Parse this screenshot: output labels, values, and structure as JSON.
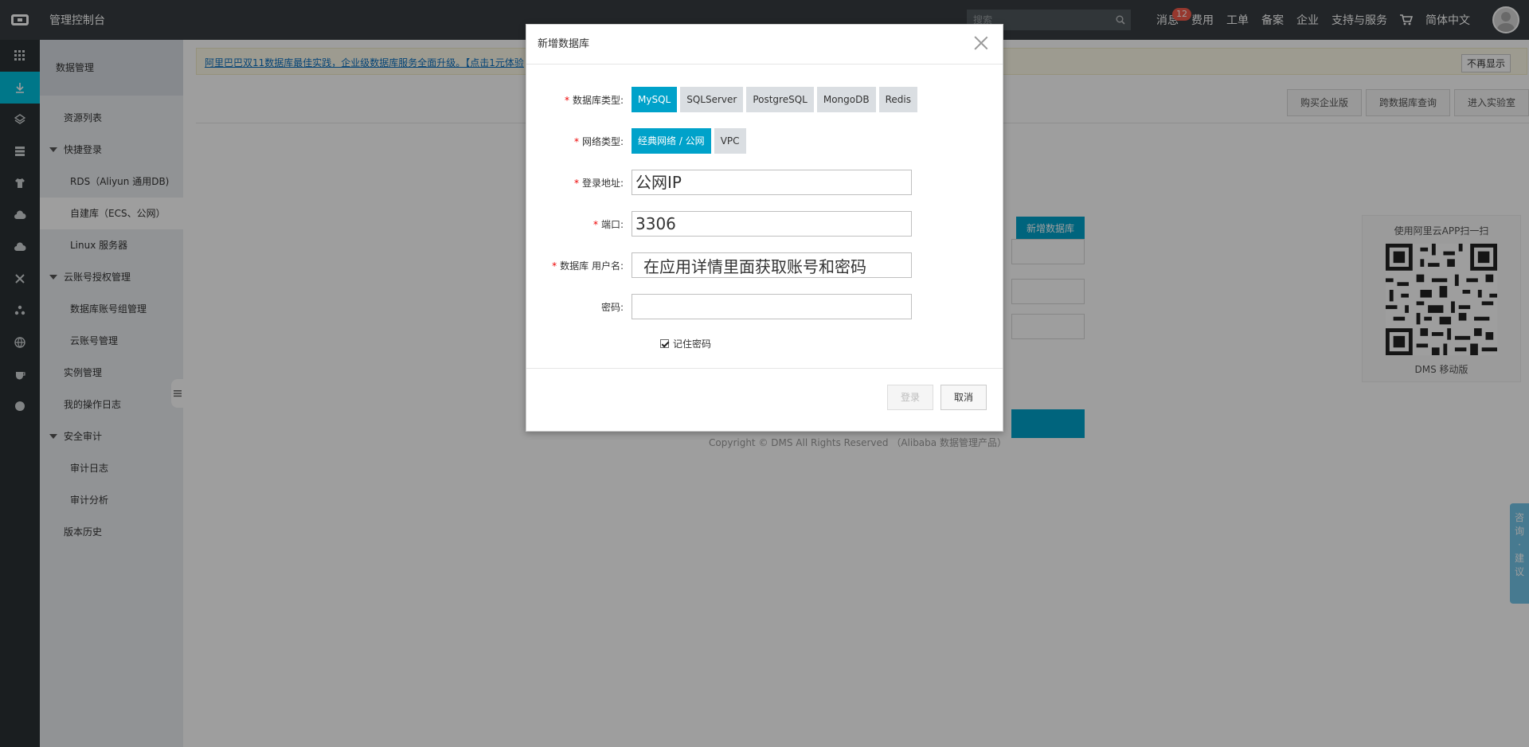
{
  "topbar": {
    "title": "管理控制台",
    "search_placeholder": "搜索",
    "nav": [
      "消息",
      "费用",
      "工单",
      "备案",
      "企业",
      "支持与服务",
      "简体中文"
    ],
    "message_badge": "12"
  },
  "sidebar": {
    "header": "数据管理",
    "items": [
      {
        "label": "资源列表",
        "kind": "item"
      },
      {
        "label": "快捷登录",
        "kind": "group"
      },
      {
        "label": "RDS（Aliyun 通用DB)",
        "kind": "sub"
      },
      {
        "label": "自建库（ECS、公网）",
        "kind": "sub",
        "active": true
      },
      {
        "label": "Linux 服务器",
        "kind": "sub"
      },
      {
        "label": "云账号授权管理",
        "kind": "group"
      },
      {
        "label": "数据库账号组管理",
        "kind": "sub"
      },
      {
        "label": "云账号管理",
        "kind": "sub"
      },
      {
        "label": "实例管理",
        "kind": "item"
      },
      {
        "label": "我的操作日志",
        "kind": "item"
      },
      {
        "label": "安全审计",
        "kind": "group"
      },
      {
        "label": "审计日志",
        "kind": "sub"
      },
      {
        "label": "审计分析",
        "kind": "sub"
      },
      {
        "label": "版本历史",
        "kind": "item"
      }
    ]
  },
  "main": {
    "notice_text": "阿里巴巴双11数据库最佳实践，企业级数据库服务全面升级。【点击1元体验",
    "notice_close": "不再显示",
    "toolbar": [
      "购买企业版",
      "跨数据库查询",
      "进入实验室"
    ],
    "bg_tab": "新增数据库",
    "qr_top": "使用阿里云APP扫一扫",
    "qr_bottom": "DMS 移动版",
    "copyright": "Copyright © DMS All Rights Reserved （Alibaba 数据管理产品）"
  },
  "feedback": [
    "咨",
    "询",
    "·",
    "建",
    "议"
  ],
  "modal": {
    "title": "新增数据库",
    "db_type_label": "数据库类型:",
    "db_types": [
      "MySQL",
      "SQLServer",
      "PostgreSQL",
      "MongoDB",
      "Redis"
    ],
    "net_type_label": "网络类型:",
    "net_types": [
      "经典网络 / 公网",
      "VPC"
    ],
    "host_label": "登录地址:",
    "host_value": "公网IP",
    "port_label": "端口:",
    "port_value": "3306",
    "user_label": "数据库 用户名:",
    "user_value": "在应用详情里面获取账号和密码",
    "password_label": "密码:",
    "password_value": "",
    "remember_label": "记住密码",
    "login_button": "登录",
    "cancel_button": "取消"
  }
}
